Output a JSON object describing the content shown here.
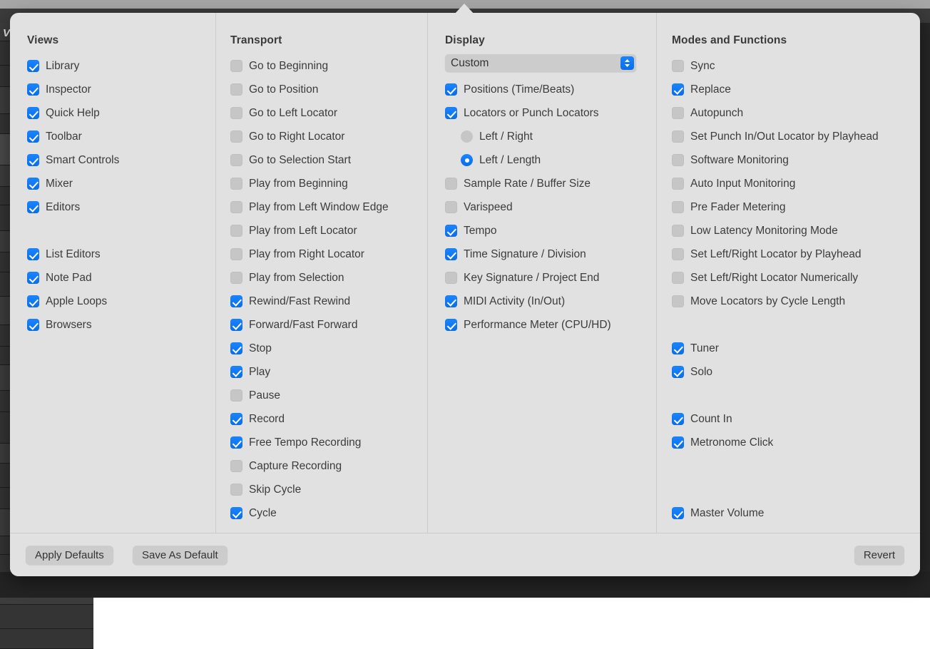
{
  "window": {
    "behind_label": "Vi"
  },
  "columns": [
    {
      "id": "views",
      "title": "Views",
      "items": [
        {
          "type": "checkbox",
          "label": "Library",
          "checked": true
        },
        {
          "type": "checkbox",
          "label": "Inspector",
          "checked": true
        },
        {
          "type": "checkbox",
          "label": "Quick Help",
          "checked": true
        },
        {
          "type": "checkbox",
          "label": "Toolbar",
          "checked": true
        },
        {
          "type": "checkbox",
          "label": "Smart Controls",
          "checked": true
        },
        {
          "type": "checkbox",
          "label": "Mixer",
          "checked": true
        },
        {
          "type": "checkbox",
          "label": "Editors",
          "checked": true
        },
        {
          "type": "spacer",
          "size": "sm"
        },
        {
          "type": "checkbox",
          "label": "List Editors",
          "checked": true
        },
        {
          "type": "checkbox",
          "label": "Note Pad",
          "checked": true
        },
        {
          "type": "checkbox",
          "label": "Apple Loops",
          "checked": true
        },
        {
          "type": "checkbox",
          "label": "Browsers",
          "checked": true
        }
      ]
    },
    {
      "id": "transport",
      "title": "Transport",
      "items": [
        {
          "type": "checkbox",
          "label": "Go to Beginning",
          "checked": false
        },
        {
          "type": "checkbox",
          "label": "Go to Position",
          "checked": false
        },
        {
          "type": "checkbox",
          "label": "Go to Left Locator",
          "checked": false
        },
        {
          "type": "checkbox",
          "label": "Go to Right Locator",
          "checked": false
        },
        {
          "type": "checkbox",
          "label": "Go to Selection Start",
          "checked": false
        },
        {
          "type": "checkbox",
          "label": "Play from Beginning",
          "checked": false
        },
        {
          "type": "checkbox",
          "label": "Play from Left Window Edge",
          "checked": false
        },
        {
          "type": "checkbox",
          "label": "Play from Left Locator",
          "checked": false
        },
        {
          "type": "checkbox",
          "label": "Play from Right Locator",
          "checked": false
        },
        {
          "type": "checkbox",
          "label": "Play from Selection",
          "checked": false
        },
        {
          "type": "checkbox",
          "label": "Rewind/Fast Rewind",
          "checked": true
        },
        {
          "type": "checkbox",
          "label": "Forward/Fast Forward",
          "checked": true
        },
        {
          "type": "checkbox",
          "label": "Stop",
          "checked": true
        },
        {
          "type": "checkbox",
          "label": "Play",
          "checked": true
        },
        {
          "type": "checkbox",
          "label": "Pause",
          "checked": false
        },
        {
          "type": "checkbox",
          "label": "Record",
          "checked": true
        },
        {
          "type": "checkbox",
          "label": "Free Tempo Recording",
          "checked": true
        },
        {
          "type": "checkbox",
          "label": "Capture Recording",
          "checked": false
        },
        {
          "type": "checkbox",
          "label": "Skip Cycle",
          "checked": false
        },
        {
          "type": "checkbox",
          "label": "Cycle",
          "checked": true
        }
      ]
    },
    {
      "id": "display",
      "title": "Display",
      "popup": {
        "value": "Custom"
      },
      "items": [
        {
          "type": "checkbox",
          "label": "Positions (Time/Beats)",
          "checked": true
        },
        {
          "type": "checkbox",
          "label": "Locators or Punch Locators",
          "checked": true
        },
        {
          "type": "radio",
          "label": "Left / Right",
          "checked": false,
          "indent": true
        },
        {
          "type": "radio",
          "label": "Left / Length",
          "checked": true,
          "indent": true
        },
        {
          "type": "checkbox",
          "label": "Sample Rate / Buffer Size",
          "checked": false
        },
        {
          "type": "checkbox",
          "label": "Varispeed",
          "checked": false
        },
        {
          "type": "checkbox",
          "label": "Tempo",
          "checked": true
        },
        {
          "type": "checkbox",
          "label": "Time Signature / Division",
          "checked": true
        },
        {
          "type": "checkbox",
          "label": "Key Signature / Project End",
          "checked": false
        },
        {
          "type": "checkbox",
          "label": "MIDI Activity (In/Out)",
          "checked": true
        },
        {
          "type": "checkbox",
          "label": "Performance Meter (CPU/HD)",
          "checked": true
        }
      ]
    },
    {
      "id": "modes",
      "title": "Modes and Functions",
      "items": [
        {
          "type": "checkbox",
          "label": "Sync",
          "checked": false
        },
        {
          "type": "checkbox",
          "label": "Replace",
          "checked": true
        },
        {
          "type": "checkbox",
          "label": "Autopunch",
          "checked": false
        },
        {
          "type": "checkbox",
          "label": "Set Punch In/Out Locator by Playhead",
          "checked": false
        },
        {
          "type": "checkbox",
          "label": "Software Monitoring",
          "checked": false
        },
        {
          "type": "checkbox",
          "label": "Auto Input Monitoring",
          "checked": false
        },
        {
          "type": "checkbox",
          "label": "Pre Fader Metering",
          "checked": false
        },
        {
          "type": "checkbox",
          "label": "Low Latency Monitoring Mode",
          "checked": false
        },
        {
          "type": "checkbox",
          "label": "Set Left/Right Locator by Playhead",
          "checked": false
        },
        {
          "type": "checkbox",
          "label": "Set Left/Right Locator Numerically",
          "checked": false
        },
        {
          "type": "checkbox",
          "label": "Move Locators by Cycle Length",
          "checked": false
        },
        {
          "type": "spacer",
          "size": "sm"
        },
        {
          "type": "checkbox",
          "label": "Tuner",
          "checked": true
        },
        {
          "type": "checkbox",
          "label": "Solo",
          "checked": true
        },
        {
          "type": "spacer",
          "size": "sm"
        },
        {
          "type": "checkbox",
          "label": "Count In",
          "checked": true
        },
        {
          "type": "checkbox",
          "label": "Metronome Click",
          "checked": true
        },
        {
          "type": "spacer",
          "size": "md"
        },
        {
          "type": "checkbox",
          "label": "Master Volume",
          "checked": true
        }
      ]
    }
  ],
  "footer": {
    "apply_defaults_label": "Apply Defaults",
    "save_as_default_label": "Save As Default",
    "revert_label": "Revert"
  },
  "colors": {
    "accent": "#007AFF",
    "panel": "#e1e1e1",
    "control": "#cccccc",
    "unchecked": "#c6c6c6",
    "text": "#3c3c3c"
  }
}
